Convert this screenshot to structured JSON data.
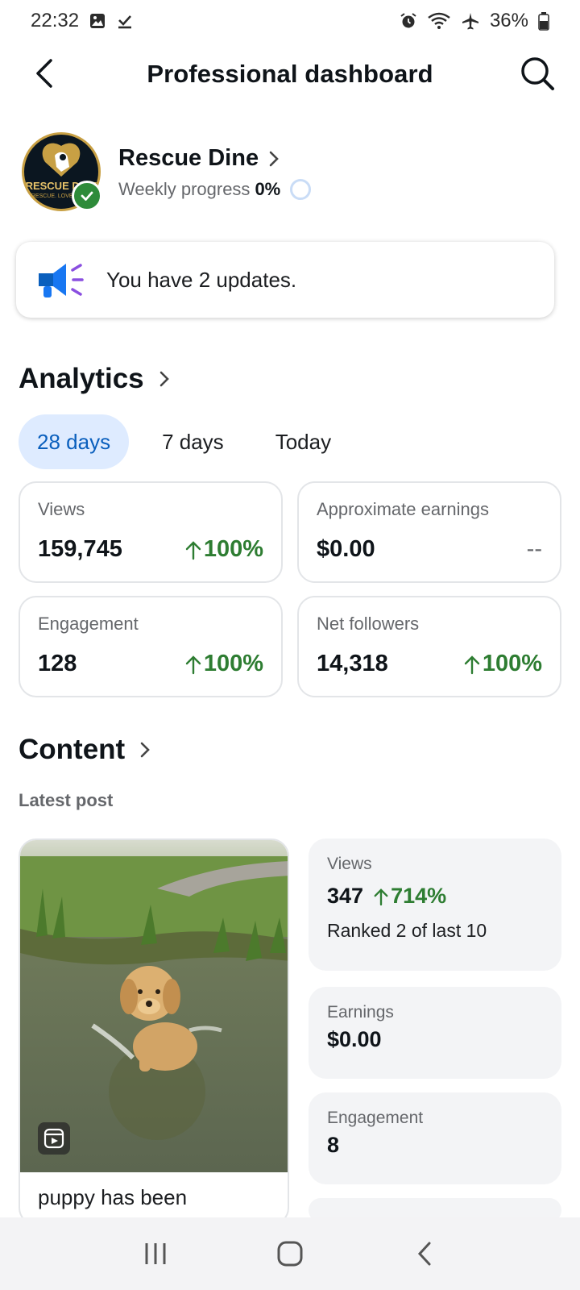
{
  "status_bar": {
    "time": "22:32",
    "battery": "36%"
  },
  "header": {
    "title": "Professional dashboard"
  },
  "profile": {
    "name": "Rescue Dine",
    "progress_label": "Weekly progress",
    "progress_value": "0%",
    "progress_fraction": 0,
    "logo_text": "RESCUE DINE",
    "logo_sub": "RESCUE. LOVE. DINE."
  },
  "updates": {
    "text": "You have 2 updates."
  },
  "analytics": {
    "title": "Analytics",
    "tabs": [
      {
        "label": "28 days"
      },
      {
        "label": "7 days"
      },
      {
        "label": "Today"
      }
    ],
    "cards": [
      {
        "label": "Views",
        "value": "159,745",
        "delta": "100%"
      },
      {
        "label": "Approximate earnings",
        "value": "$0.00",
        "delta": "--"
      },
      {
        "label": "Engagement",
        "value": "128",
        "delta": "100%"
      },
      {
        "label": "Net followers",
        "value": "14,318",
        "delta": "100%"
      }
    ]
  },
  "content": {
    "title": "Content",
    "latest_label": "Latest post",
    "post_caption": "puppy has been",
    "stats": {
      "views_label": "Views",
      "views_value": "347",
      "views_delta": "714%",
      "rank": "Ranked 2 of last 10",
      "earnings_label": "Earnings",
      "earnings_value": "$0.00",
      "engagement_label": "Engagement",
      "engagement_value": "8"
    }
  },
  "colors": {
    "accent_blue": "#0a5fbd",
    "tab_active_bg": "#deebff",
    "positive_green": "#2e7d32",
    "verified_green": "#2e8b3a"
  }
}
